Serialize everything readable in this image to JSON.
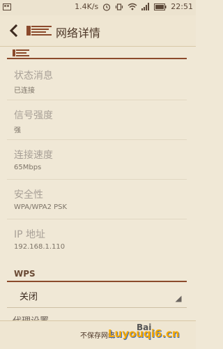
{
  "status_bar": {
    "left_icon": "notification-icon",
    "speed": "1.4K/s",
    "time": "22:51"
  },
  "header": {
    "back_icon": "back-arrow-icon",
    "logo_icon": "brand-logo-icon",
    "title": "网络详情"
  },
  "details": {
    "items": [
      {
        "title": "状态消息",
        "value": "已连接"
      },
      {
        "title": "信号强度",
        "value": "强"
      },
      {
        "title": "连接速度",
        "value": "65Mbps"
      },
      {
        "title": "安全性",
        "value": "WPA/WPA2 PSK"
      },
      {
        "title": "IP 地址",
        "value": "192.168.1.110"
      }
    ]
  },
  "wps": {
    "header": "WPS",
    "selected": "关闭"
  },
  "partial_item": "代理设置",
  "footer": {
    "button": "不保存网络"
  },
  "watermark": {
    "text1": "Bai",
    "text2": "Luyouqi6.cn"
  },
  "colors": {
    "background": "#f0e8d6",
    "accent_line": "#8b4a2c",
    "muted_title": "#a8a097"
  }
}
